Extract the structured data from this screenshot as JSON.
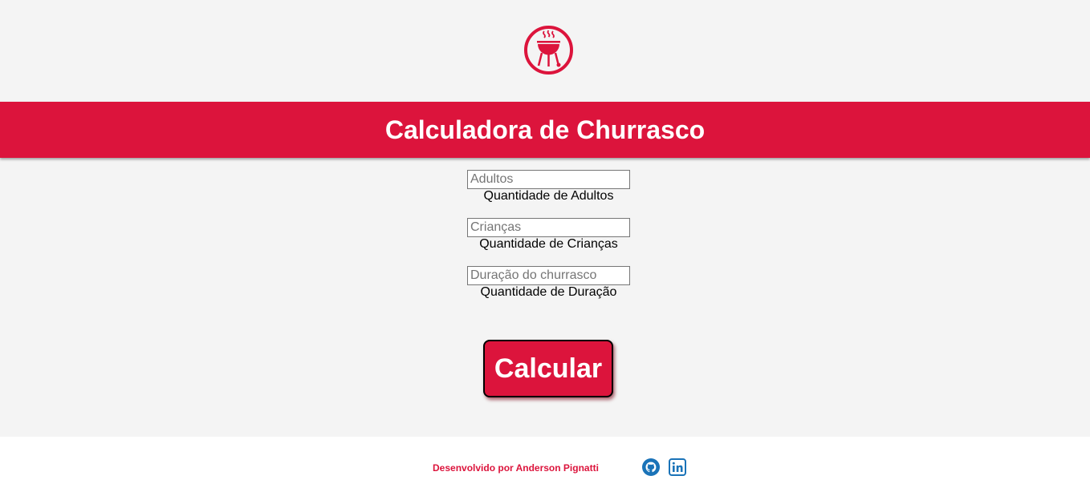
{
  "colors": {
    "accent": "#dc143c",
    "background": "#f4f4f4",
    "footer_bg": "#ffffff",
    "social_blue": "#1a73b8"
  },
  "logo": {
    "icon": "barbecue-grill-icon"
  },
  "header": {
    "title": "Calculadora de Churrasco"
  },
  "form": {
    "adults": {
      "placeholder": "Adultos",
      "value": "",
      "label": "Quantidade de Adultos"
    },
    "children": {
      "placeholder": "Crianças",
      "value": "",
      "label": "Quantidade de Crianças"
    },
    "duration": {
      "placeholder": "Duração do churrasco",
      "value": "",
      "label": "Quantidade de Duração"
    },
    "submit_label": "Calcular"
  },
  "footer": {
    "credit": "Desenvolvido por Anderson Pignatti",
    "links": [
      {
        "icon": "github-icon"
      },
      {
        "icon": "linkedin-icon"
      }
    ]
  }
}
